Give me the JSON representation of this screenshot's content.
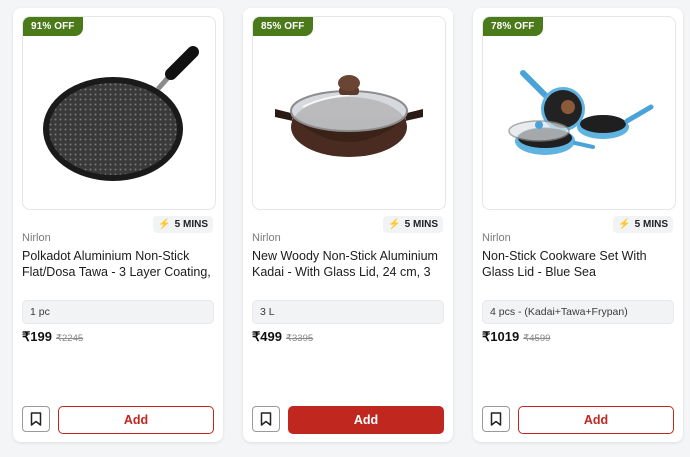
{
  "products": [
    {
      "discount": "91% OFF",
      "eta": "5 MINS",
      "brand": "Nirlon",
      "title": "Polkadot Aluminium Non-Stick Flat/Dosa Tawa - 3 Layer Coating,",
      "variant": "1 pc",
      "price": "₹199",
      "mrp": "₹2245",
      "add_label": "Add",
      "add_style": "outline",
      "image_icon": "tawa-pan-image"
    },
    {
      "discount": "85% OFF",
      "eta": "5 MINS",
      "brand": "Nirlon",
      "title": "New Woody Non-Stick Aluminium Kadai - With Glass Lid, 24 cm, 3",
      "variant": "3 L",
      "price": "₹499",
      "mrp": "₹3395",
      "add_label": "Add",
      "add_style": "filled",
      "image_icon": "kadai-image"
    },
    {
      "discount": "78% OFF",
      "eta": "5 MINS",
      "brand": "Nirlon",
      "title": "Non-Stick Cookware Set With Glass Lid - Blue Sea",
      "variant": "4 pcs - (Kadai+Tawa+Frypan)",
      "price": "₹1019",
      "mrp": "₹4599",
      "add_label": "Add",
      "add_style": "outline",
      "image_icon": "cookware-set-image"
    }
  ],
  "colors": {
    "discount_badge": "#4b7a1a",
    "add_button": "#c0271f",
    "eta_icon": "#2f7a20"
  }
}
